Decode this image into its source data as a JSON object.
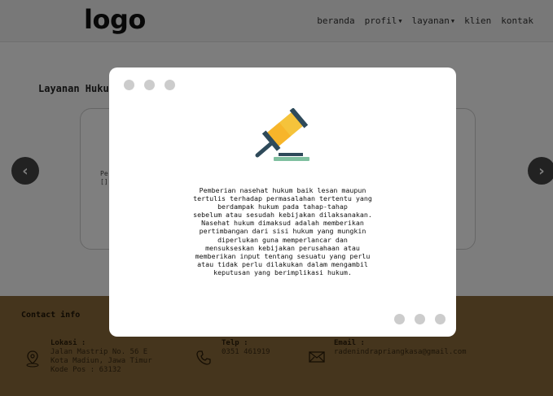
{
  "header": {
    "logo": "logo",
    "nav": [
      {
        "label": "beranda",
        "dropdown": false
      },
      {
        "label": "profil",
        "dropdown": true
      },
      {
        "label": "layanan",
        "dropdown": true
      },
      {
        "label": "klien",
        "dropdown": false
      },
      {
        "label": "kontak",
        "dropdown": false
      }
    ]
  },
  "main": {
    "section_title": "Layanan Hukum",
    "card_snippet_line1": "Pe",
    "card_snippet_line2": "[]"
  },
  "footer": {
    "title": "Contact info",
    "location": {
      "label": "Lokasi :",
      "text": "Jalan Mastrip No. 56 E\nKota Madiun, Jawa Timur\nKode Pos : 63132",
      "icon": "location-pin-icon"
    },
    "phone": {
      "label": "Telp :",
      "text": "0351 461919",
      "icon": "phone-icon"
    },
    "email": {
      "label": "Email :",
      "text": "radenindrapriangkasa@gmail.com",
      "icon": "mail-icon"
    }
  },
  "modal": {
    "icon": "gavel-icon",
    "text": "Pemberian nasehat hukum baik lesan maupun\ntertulis terhadap permasalahan tertentu yang\nberdampak hukum pada tahap-tahap\nsebelum atau sesudah kebijakan dilaksanakan.\nNasehat hukum dimaksud adalah memberikan\npertimbangan dari sisi hukum yang mungkin\ndiperlukan guna memperlancar dan\nmensukseskan kebijakan perusahaan atau\nmemberikan input tentang sesuatu yang perlu\natau tidak perlu dilakukan dalam mengambil\nkeputusan yang berimplikasi hukum."
  },
  "colors": {
    "overlay": "#000000",
    "footer": "#8a6a3a",
    "gavel_head": "#f5c33b",
    "gavel_handle": "#2e4a5a",
    "gavel_base": "#7fbf9f"
  }
}
